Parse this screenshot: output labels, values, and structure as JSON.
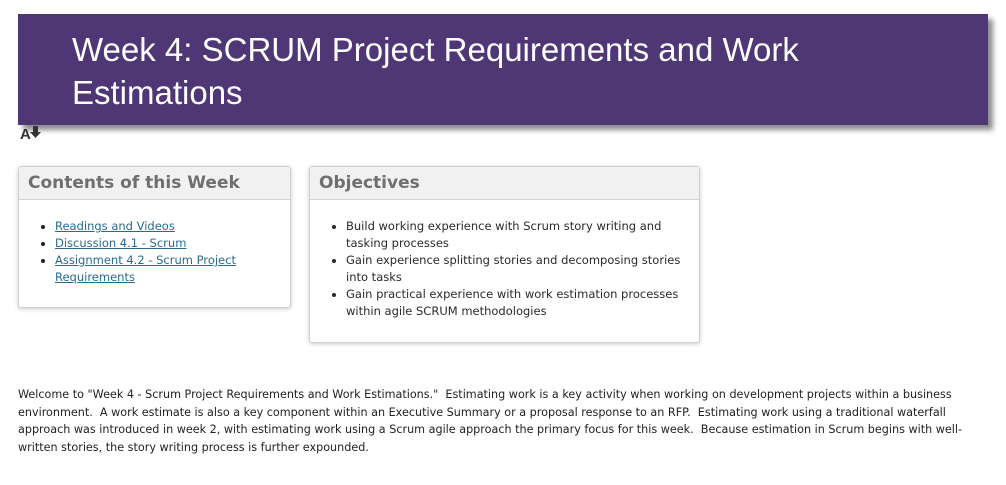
{
  "header": {
    "title": "Week 4: SCRUM Project Requirements and Work Estimations",
    "background_color": "#4f3675",
    "text_color": "#ffffff"
  },
  "toolbar": {
    "immersive_reader_icon": "immersive-reader-icon"
  },
  "contents_panel": {
    "title": "Contents of this Week",
    "links": [
      {
        "label": "Readings and Videos"
      },
      {
        "label": "Discussion 4.1 - Scrum"
      },
      {
        "label": "Assignment 4.2 - Scrum Project Requirements"
      }
    ],
    "link_color": "#2b6a8f"
  },
  "objectives_panel": {
    "title": "Objectives",
    "items": [
      "Build working experience with Scrum story writing and tasking processes",
      "Gain experience splitting stories and decomposing stories into tasks",
      "Gain practical experience with work estimation processes within agile SCRUM methodologies"
    ]
  },
  "intro": {
    "text": "Welcome to \"Week 4 - Scrum Project Requirements and Work Estimations.\"  Estimating work is a key activity when working on development projects within a business environment.  A work estimate is also a key component within an Executive Summary or a proposal response to an RFP.  Estimating work using a traditional waterfall approach was introduced in week 2, with estimating work using a Scrum agile approach the primary focus for this week.  Because estimation in Scrum begins with well-written stories, the story writing process is further expounded."
  }
}
